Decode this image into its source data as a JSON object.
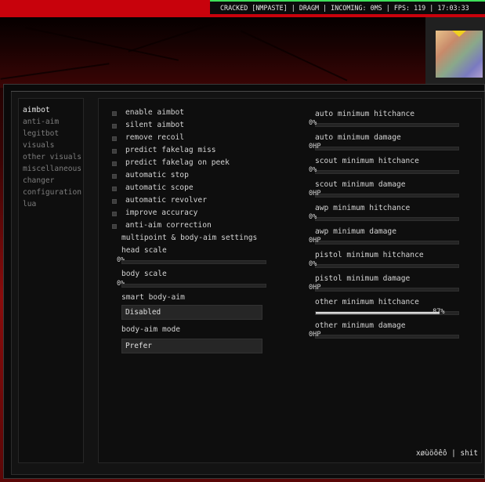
{
  "hud": {
    "text": "CRACKED [NMPASTE] | DRAGM | INCOMING: 0MS | FPS: 119 | 17:03:33"
  },
  "colors": {
    "accent": "#c8020c",
    "hud_green": "#3ee05a"
  },
  "sidebar": {
    "items": [
      {
        "label": "aimbot",
        "active": true
      },
      {
        "label": "anti-aim",
        "active": false
      },
      {
        "label": "legitbot",
        "active": false
      },
      {
        "label": "visuals",
        "active": false
      },
      {
        "label": "other visuals",
        "active": false
      },
      {
        "label": "miscellaneous",
        "active": false
      },
      {
        "label": "changer",
        "active": false
      },
      {
        "label": "configuration",
        "active": false
      },
      {
        "label": "lua",
        "active": false
      }
    ]
  },
  "aimbot": {
    "checkboxes": [
      {
        "label": "enable aimbot",
        "checked": false
      },
      {
        "label": "silent aimbot",
        "checked": false
      },
      {
        "label": "remove recoil",
        "checked": false
      },
      {
        "label": "predict fakelag miss",
        "checked": false
      },
      {
        "label": "predict fakelag on peek",
        "checked": false
      },
      {
        "label": "automatic stop",
        "checked": false
      },
      {
        "label": "automatic scope",
        "checked": false
      },
      {
        "label": "automatic revolver",
        "checked": false
      },
      {
        "label": "improve accuracy",
        "checked": false
      },
      {
        "label": "anti-aim correction",
        "checked": false
      }
    ],
    "multipoint_header": "multipoint & body-aim settings",
    "head_scale": {
      "label": "head scale",
      "value_text": "0%",
      "value": 0
    },
    "body_scale": {
      "label": "body scale",
      "value_text": "0%",
      "value": 0
    },
    "smart_body_aim": {
      "label": "smart body-aim",
      "selected": "Disabled"
    },
    "body_aim_mode": {
      "label": "body-aim mode",
      "selected": "Prefer"
    },
    "sliders": [
      {
        "label": "auto minimum hitchance",
        "value_text": "0%",
        "value": 0
      },
      {
        "label": "auto minimum damage",
        "value_text": "0HP",
        "value": 0
      },
      {
        "label": "scout minimum hitchance",
        "value_text": "0%",
        "value": 0
      },
      {
        "label": "scout minimum damage",
        "value_text": "0HP",
        "value": 0
      },
      {
        "label": "awp minimum hitchance",
        "value_text": "0%",
        "value": 0
      },
      {
        "label": "awp minimum damage",
        "value_text": "0HP",
        "value": 0
      },
      {
        "label": "pistol minimum hitchance",
        "value_text": "0%",
        "value": 0
      },
      {
        "label": "pistol minimum damage",
        "value_text": "0HP",
        "value": 0
      },
      {
        "label": "other minimum hitchance",
        "value_text": "87%",
        "value": 0.87
      },
      {
        "label": "other minimum damage",
        "value_text": "0HP",
        "value": 0
      }
    ]
  },
  "footer": {
    "text": "xøùöôêô | shit"
  }
}
